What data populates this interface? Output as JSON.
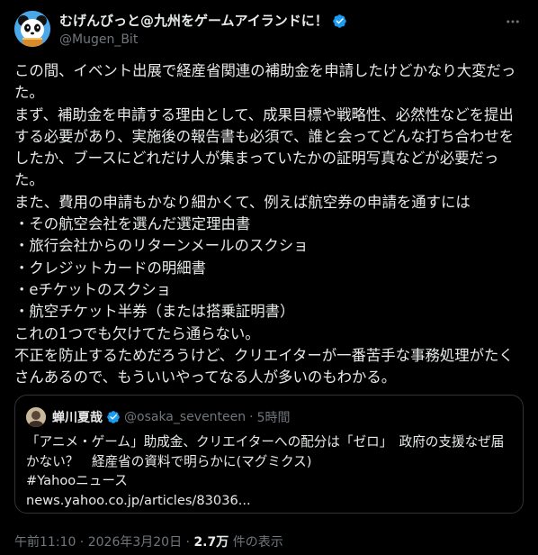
{
  "author": {
    "display_name": "むげんびっと@九州をゲームアイランドに！",
    "handle": "@Mugen_Bit",
    "verified_color": "#1d9bf0"
  },
  "more_icon": "more-horizontal-icon",
  "tweet": {
    "text": "この間、イベント出展で経産省関連の補助金を申請したけどかなり大変だった。\nまず、補助金を申請する理由として、成果目標や戦略性、必然性などを提出する必要があり、実施後の報告書も必須で、誰と会ってどんな打ち合わせをしたか、ブースにどれだけ人が集まっていたかの証明写真などが必要だった。\nまた、費用の申請もかなり細かくて、例えば航空券の申請を通すには\n・その航空会社を選んだ選定理由書\n・旅行会社からのリターンメールのスクショ\n・クレジットカードの明細書\n・eチケットのスクショ\n・航空チケット半券（または搭乗証明書）\nこれの1つでも欠けてたら通らない。\n不正を防止するためだろうけど、クリエイターが一番苦手な事務処理がたくさんあるので、もういいやってなる人が多いのもわかる。"
  },
  "quote": {
    "name": "蝉川夏哉",
    "handle": "@osaka_seventeen",
    "separator": "·",
    "time": "5時間",
    "text": "「アニメ・ゲーム」助成金、クリエイターへの配分は「ゼロ」　政府の支援なぜ届かない？　経産省の資料で明らかに(マグミクス)\n#Yahooニュース\nnews.yahoo.co.jp/articles/83036..."
  },
  "meta": {
    "time": "午前11:10",
    "sep1": " · ",
    "date": "2026年3月20日",
    "sep2": " · ",
    "views": "2.7万",
    "views_label": " 件の表示"
  }
}
